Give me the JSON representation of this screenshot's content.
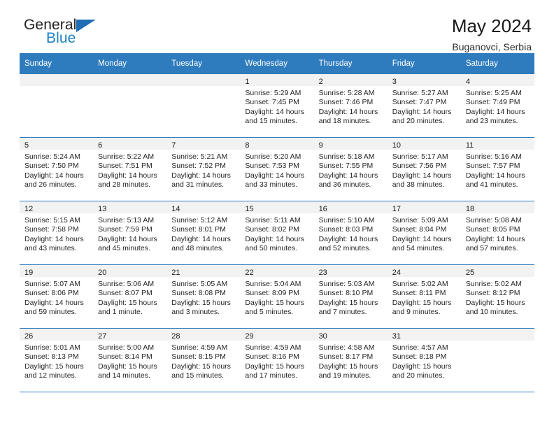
{
  "logo": {
    "word_top": "General",
    "word_bottom": "Blue",
    "triangle": "blue-triangle-icon"
  },
  "header": {
    "title": "May 2024",
    "subtitle": "Buganovci, Serbia"
  },
  "colors": {
    "header_blue": "#2e7cbe",
    "logo_blue": "#1c7fc4",
    "daynum_band": "#f2f2f2",
    "text": "#242424"
  },
  "weekday_headers": [
    "Sunday",
    "Monday",
    "Tuesday",
    "Wednesday",
    "Thursday",
    "Friday",
    "Saturday"
  ],
  "weeks": [
    [
      {
        "empty": true
      },
      {
        "empty": true
      },
      {
        "empty": true
      },
      {
        "day": "1",
        "sunrise": "Sunrise: 5:29 AM",
        "sunset": "Sunset: 7:45 PM",
        "daylight1": "Daylight: 14 hours",
        "daylight2": "and 15 minutes."
      },
      {
        "day": "2",
        "sunrise": "Sunrise: 5:28 AM",
        "sunset": "Sunset: 7:46 PM",
        "daylight1": "Daylight: 14 hours",
        "daylight2": "and 18 minutes."
      },
      {
        "day": "3",
        "sunrise": "Sunrise: 5:27 AM",
        "sunset": "Sunset: 7:47 PM",
        "daylight1": "Daylight: 14 hours",
        "daylight2": "and 20 minutes."
      },
      {
        "day": "4",
        "sunrise": "Sunrise: 5:25 AM",
        "sunset": "Sunset: 7:49 PM",
        "daylight1": "Daylight: 14 hours",
        "daylight2": "and 23 minutes."
      }
    ],
    [
      {
        "day": "5",
        "sunrise": "Sunrise: 5:24 AM",
        "sunset": "Sunset: 7:50 PM",
        "daylight1": "Daylight: 14 hours",
        "daylight2": "and 26 minutes."
      },
      {
        "day": "6",
        "sunrise": "Sunrise: 5:22 AM",
        "sunset": "Sunset: 7:51 PM",
        "daylight1": "Daylight: 14 hours",
        "daylight2": "and 28 minutes."
      },
      {
        "day": "7",
        "sunrise": "Sunrise: 5:21 AM",
        "sunset": "Sunset: 7:52 PM",
        "daylight1": "Daylight: 14 hours",
        "daylight2": "and 31 minutes."
      },
      {
        "day": "8",
        "sunrise": "Sunrise: 5:20 AM",
        "sunset": "Sunset: 7:53 PM",
        "daylight1": "Daylight: 14 hours",
        "daylight2": "and 33 minutes."
      },
      {
        "day": "9",
        "sunrise": "Sunrise: 5:18 AM",
        "sunset": "Sunset: 7:55 PM",
        "daylight1": "Daylight: 14 hours",
        "daylight2": "and 36 minutes."
      },
      {
        "day": "10",
        "sunrise": "Sunrise: 5:17 AM",
        "sunset": "Sunset: 7:56 PM",
        "daylight1": "Daylight: 14 hours",
        "daylight2": "and 38 minutes."
      },
      {
        "day": "11",
        "sunrise": "Sunrise: 5:16 AM",
        "sunset": "Sunset: 7:57 PM",
        "daylight1": "Daylight: 14 hours",
        "daylight2": "and 41 minutes."
      }
    ],
    [
      {
        "day": "12",
        "sunrise": "Sunrise: 5:15 AM",
        "sunset": "Sunset: 7:58 PM",
        "daylight1": "Daylight: 14 hours",
        "daylight2": "and 43 minutes."
      },
      {
        "day": "13",
        "sunrise": "Sunrise: 5:13 AM",
        "sunset": "Sunset: 7:59 PM",
        "daylight1": "Daylight: 14 hours",
        "daylight2": "and 45 minutes."
      },
      {
        "day": "14",
        "sunrise": "Sunrise: 5:12 AM",
        "sunset": "Sunset: 8:01 PM",
        "daylight1": "Daylight: 14 hours",
        "daylight2": "and 48 minutes."
      },
      {
        "day": "15",
        "sunrise": "Sunrise: 5:11 AM",
        "sunset": "Sunset: 8:02 PM",
        "daylight1": "Daylight: 14 hours",
        "daylight2": "and 50 minutes."
      },
      {
        "day": "16",
        "sunrise": "Sunrise: 5:10 AM",
        "sunset": "Sunset: 8:03 PM",
        "daylight1": "Daylight: 14 hours",
        "daylight2": "and 52 minutes."
      },
      {
        "day": "17",
        "sunrise": "Sunrise: 5:09 AM",
        "sunset": "Sunset: 8:04 PM",
        "daylight1": "Daylight: 14 hours",
        "daylight2": "and 54 minutes."
      },
      {
        "day": "18",
        "sunrise": "Sunrise: 5:08 AM",
        "sunset": "Sunset: 8:05 PM",
        "daylight1": "Daylight: 14 hours",
        "daylight2": "and 57 minutes."
      }
    ],
    [
      {
        "day": "19",
        "sunrise": "Sunrise: 5:07 AM",
        "sunset": "Sunset: 8:06 PM",
        "daylight1": "Daylight: 14 hours",
        "daylight2": "and 59 minutes."
      },
      {
        "day": "20",
        "sunrise": "Sunrise: 5:06 AM",
        "sunset": "Sunset: 8:07 PM",
        "daylight1": "Daylight: 15 hours",
        "daylight2": "and 1 minute."
      },
      {
        "day": "21",
        "sunrise": "Sunrise: 5:05 AM",
        "sunset": "Sunset: 8:08 PM",
        "daylight1": "Daylight: 15 hours",
        "daylight2": "and 3 minutes."
      },
      {
        "day": "22",
        "sunrise": "Sunrise: 5:04 AM",
        "sunset": "Sunset: 8:09 PM",
        "daylight1": "Daylight: 15 hours",
        "daylight2": "and 5 minutes."
      },
      {
        "day": "23",
        "sunrise": "Sunrise: 5:03 AM",
        "sunset": "Sunset: 8:10 PM",
        "daylight1": "Daylight: 15 hours",
        "daylight2": "and 7 minutes."
      },
      {
        "day": "24",
        "sunrise": "Sunrise: 5:02 AM",
        "sunset": "Sunset: 8:11 PM",
        "daylight1": "Daylight: 15 hours",
        "daylight2": "and 9 minutes."
      },
      {
        "day": "25",
        "sunrise": "Sunrise: 5:02 AM",
        "sunset": "Sunset: 8:12 PM",
        "daylight1": "Daylight: 15 hours",
        "daylight2": "and 10 minutes."
      }
    ],
    [
      {
        "day": "26",
        "sunrise": "Sunrise: 5:01 AM",
        "sunset": "Sunset: 8:13 PM",
        "daylight1": "Daylight: 15 hours",
        "daylight2": "and 12 minutes."
      },
      {
        "day": "27",
        "sunrise": "Sunrise: 5:00 AM",
        "sunset": "Sunset: 8:14 PM",
        "daylight1": "Daylight: 15 hours",
        "daylight2": "and 14 minutes."
      },
      {
        "day": "28",
        "sunrise": "Sunrise: 4:59 AM",
        "sunset": "Sunset: 8:15 PM",
        "daylight1": "Daylight: 15 hours",
        "daylight2": "and 15 minutes."
      },
      {
        "day": "29",
        "sunrise": "Sunrise: 4:59 AM",
        "sunset": "Sunset: 8:16 PM",
        "daylight1": "Daylight: 15 hours",
        "daylight2": "and 17 minutes."
      },
      {
        "day": "30",
        "sunrise": "Sunrise: 4:58 AM",
        "sunset": "Sunset: 8:17 PM",
        "daylight1": "Daylight: 15 hours",
        "daylight2": "and 19 minutes."
      },
      {
        "day": "31",
        "sunrise": "Sunrise: 4:57 AM",
        "sunset": "Sunset: 8:18 PM",
        "daylight1": "Daylight: 15 hours",
        "daylight2": "and 20 minutes."
      },
      {
        "empty": true
      }
    ]
  ]
}
